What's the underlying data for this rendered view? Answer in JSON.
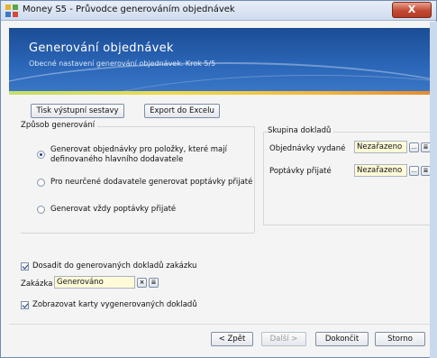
{
  "window": {
    "title": "Money S5 - Průvodce generováním objednávek",
    "close_label": "X"
  },
  "header": {
    "title": "Generování objednávek",
    "subtitle": "Obecné nastavení generování objednávek. Krok 5/5"
  },
  "toolbar": {
    "print_label": "Tisk výstupní sestavy",
    "export_label": "Export do Excelu"
  },
  "method_group": {
    "label": "Způsob generování",
    "options": [
      {
        "label_line1": "Generovat objednávky pro položky, které mají",
        "label_line2": "definovaného hlavního dodavatele",
        "selected": true
      },
      {
        "label_line1": "Pro neurčené dodavatele generovat poptávky přijaté",
        "label_line2": "",
        "selected": false
      },
      {
        "label_line1": "Generovat vždy poptávky přijaté",
        "label_line2": "",
        "selected": false
      }
    ]
  },
  "doc_group": {
    "label": "Skupina dokladů",
    "rows": [
      {
        "label": "Objednávky vydané",
        "value": "Nezařazeno"
      },
      {
        "label": "Poptávky přijaté",
        "value": "Nezařazeno"
      }
    ],
    "ellipsis_label": "...",
    "list_icon_label": "≣"
  },
  "order_section": {
    "checkbox_label": "Dosadit do generovaných dokladů zakázku",
    "checked": true,
    "zakazka_label": "Zakázka",
    "zakazka_value": "Generováno",
    "clear_label": "×",
    "list_icon_label": "≣"
  },
  "cards_section": {
    "checkbox_label": "Zobrazovat karty vygenerovaných dokladů",
    "checked": true
  },
  "footer": {
    "back_label": "< Zpět",
    "next_label": "Další >",
    "finish_label": "Dokončit",
    "cancel_label": "Storno"
  }
}
